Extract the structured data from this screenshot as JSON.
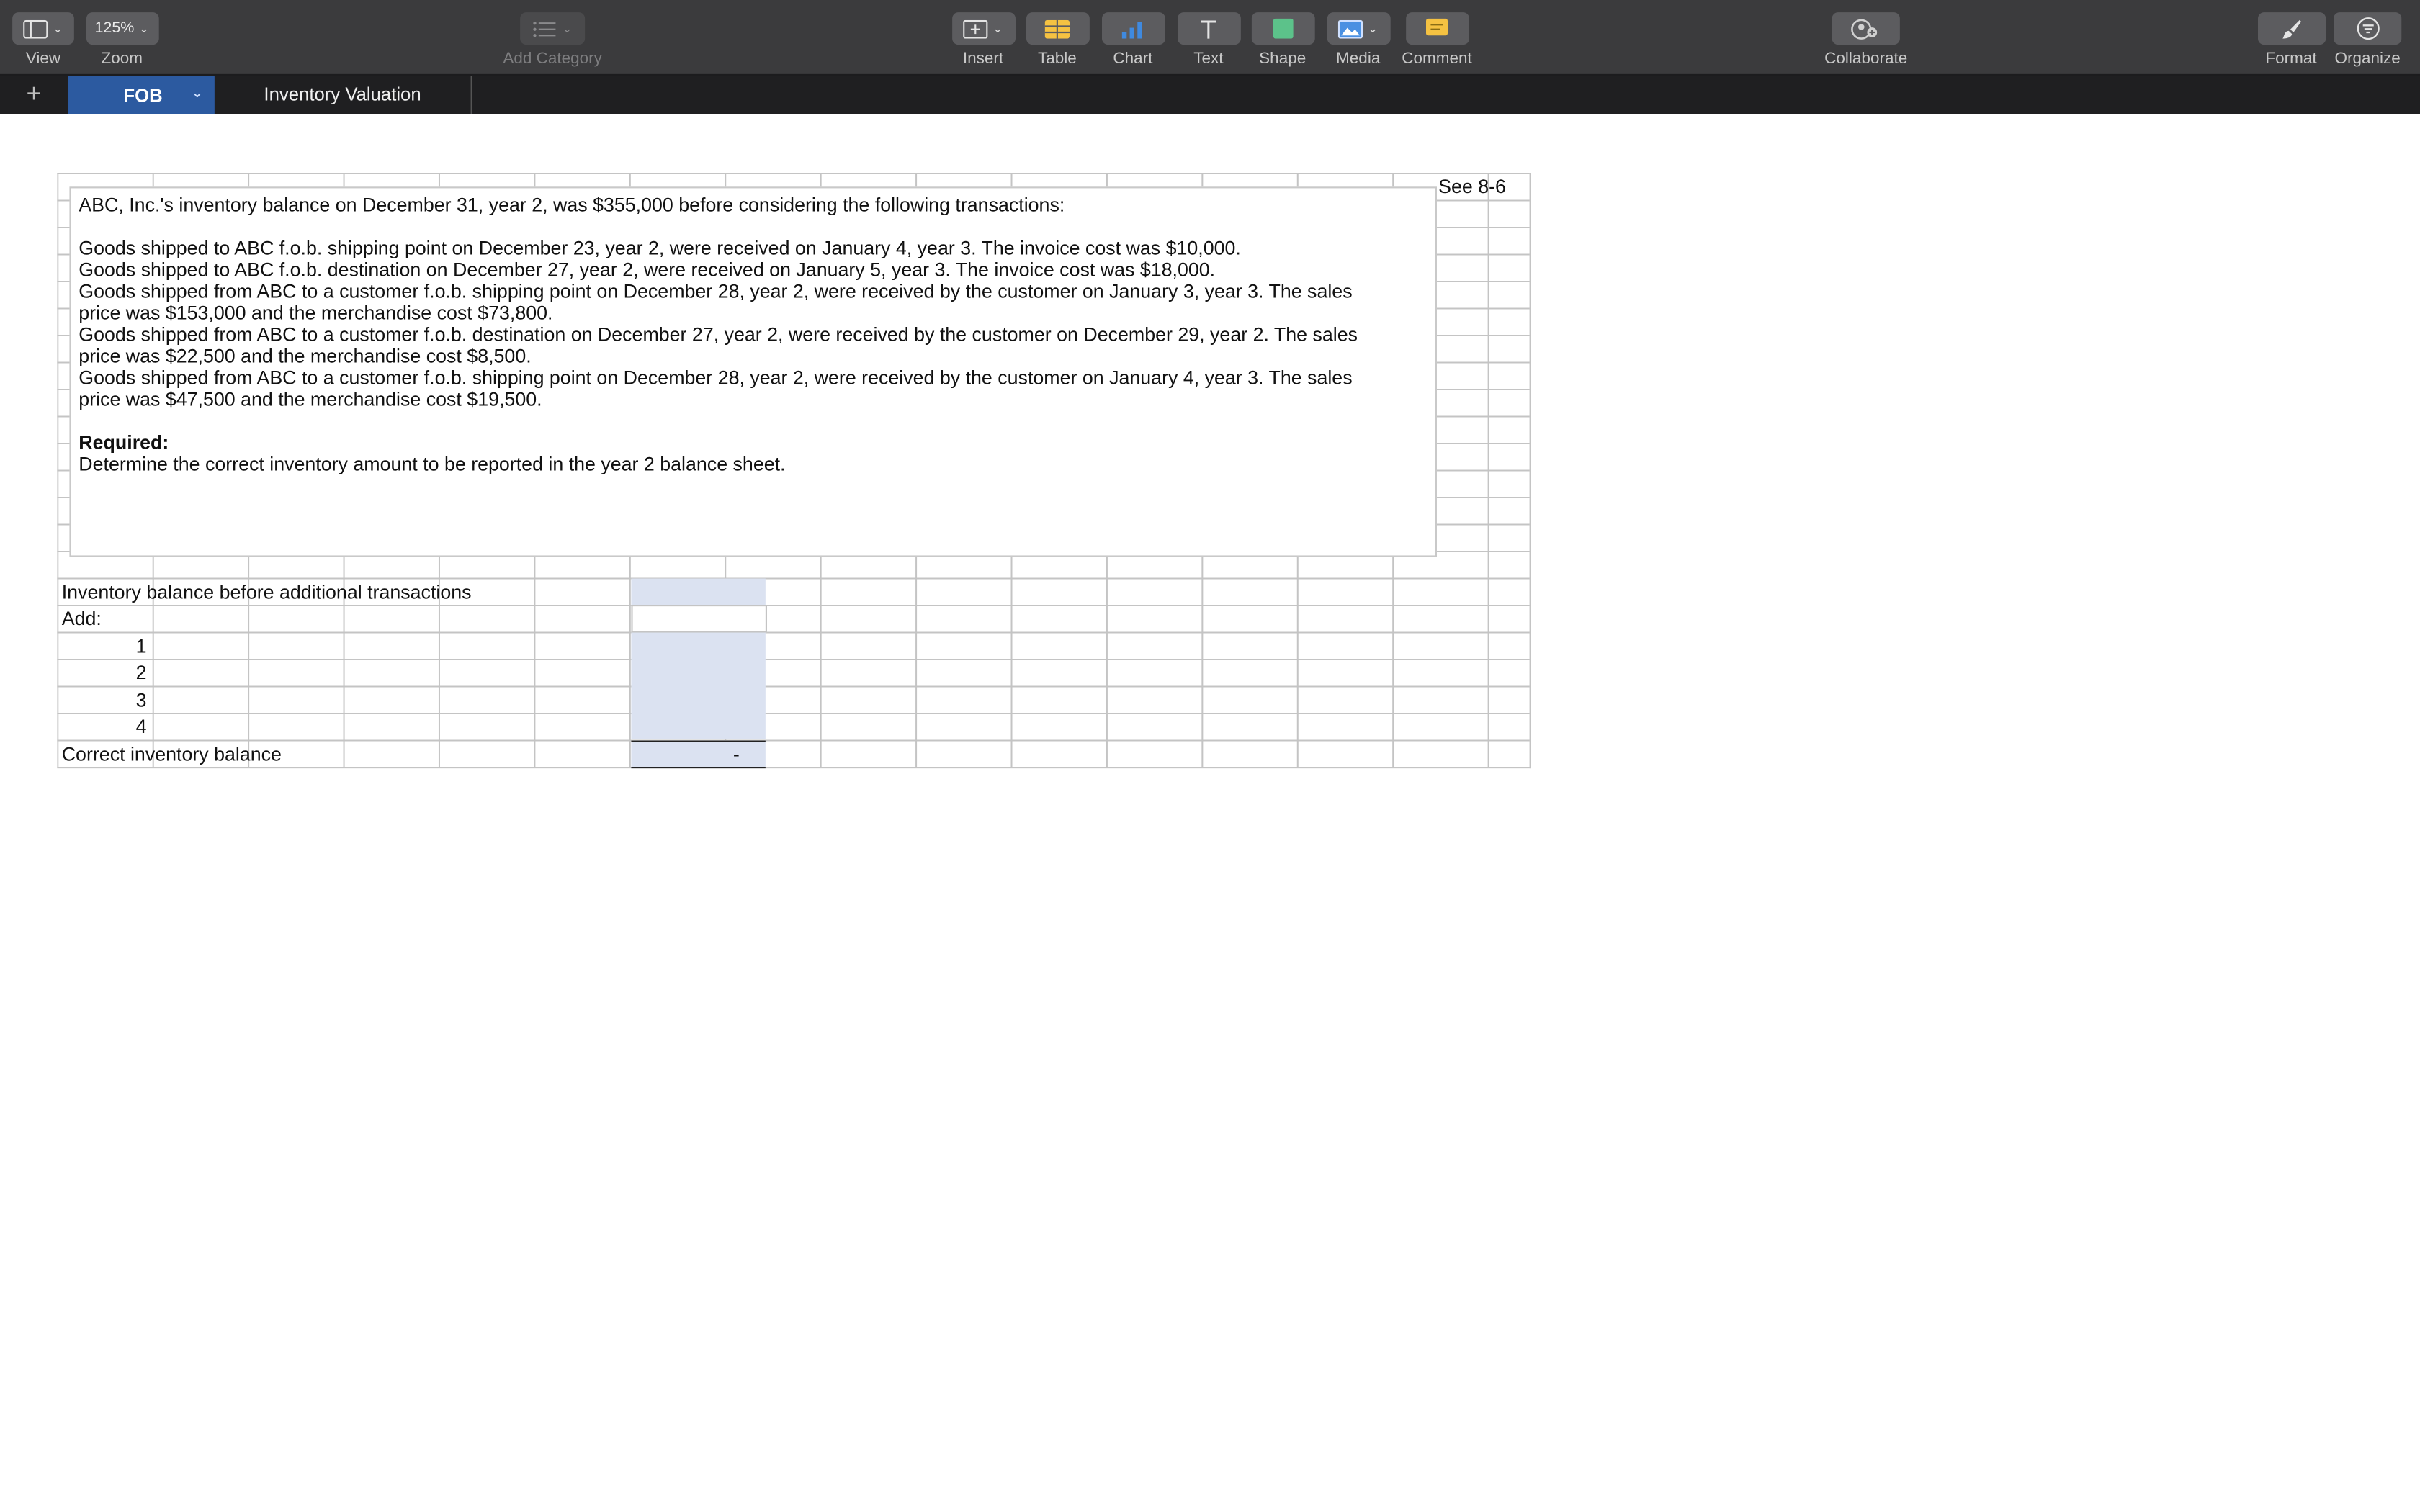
{
  "toolbar": {
    "view": {
      "label": "View"
    },
    "zoom": {
      "value": "125%",
      "label": "Zoom"
    },
    "add_category": {
      "label": "Add Category"
    },
    "insert": {
      "label": "Insert"
    },
    "table": {
      "label": "Table"
    },
    "chart": {
      "label": "Chart"
    },
    "text": {
      "label": "Text"
    },
    "shape": {
      "label": "Shape"
    },
    "media": {
      "label": "Media"
    },
    "comment": {
      "label": "Comment"
    },
    "collaborate": {
      "label": "Collaborate"
    },
    "format": {
      "label": "Format"
    },
    "organize": {
      "label": "Organize"
    }
  },
  "sheets": {
    "add_symbol": "+",
    "tabs": [
      {
        "label": "FOB"
      },
      {
        "label": "Inventory Valuation"
      }
    ]
  },
  "sheet": {
    "see_ref": "See 8-6",
    "problem": {
      "intro": "ABC, Inc.'s inventory balance on December 31, year 2, was $355,000 before considering the following transactions:",
      "t1": "Goods shipped to ABC f.o.b. shipping point  on December 23, year 2, were received on January 4, year 3. The invoice cost was $10,000.",
      "t2": "Goods shipped to ABC f.o.b. destination on December 27, year 2, were received on January 5, year 3. The invoice cost was $18,000.",
      "t3a": "Goods shipped from ABC to a customer f.o.b. shipping point on December 28, year 2, were received by the customer on January 3, year 3. The sales",
      "t3b": "price was $153,000 and the merchandise cost $73,800.",
      "t4a": "Goods shipped from ABC to a customer f.o.b. destination on December 27, year 2, were received by the customer on December 29, year 2. The sales",
      "t4b": "price was $22,500 and the merchandise cost $8,500.",
      "t5a": "Goods shipped from ABC to a customer f.o.b. shipping point on December 28, year 2, were received by the customer on January 4, year 3. The sales",
      "t5b": "price was $47,500 and the merchandise cost $19,500.",
      "required_label": "Required:",
      "required_text": "Determine the correct inventory amount to be reported in the year 2 balance sheet."
    },
    "table": {
      "row_before": "Inventory balance before additional transactions",
      "row_add": "Add:",
      "items": [
        "1",
        "2",
        "3",
        "4"
      ],
      "row_correct": "Correct inventory balance",
      "correct_value": "-"
    }
  }
}
